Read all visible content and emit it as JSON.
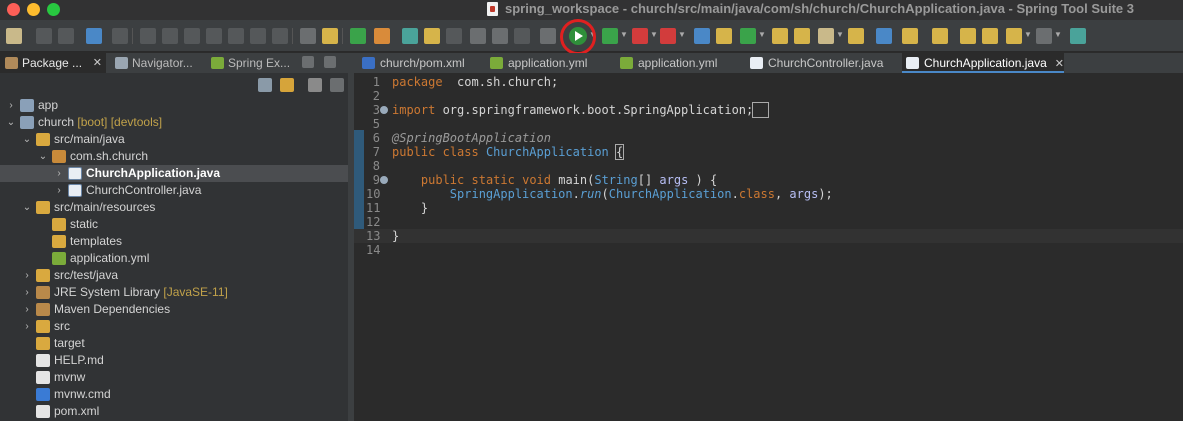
{
  "window": {
    "title": "spring_workspace - church/src/main/java/com/sh/church/ChurchApplication.java - Spring Tool Suite 3"
  },
  "toolbar": {
    "run_button_icon": "run-icon",
    "run_highlight_color": "#e02020"
  },
  "left_panel": {
    "tabs": [
      {
        "label": "Package ...",
        "icon": "package-explorer-icon",
        "active": true
      },
      {
        "label": "Navigator...",
        "icon": "navigator-icon",
        "active": false
      },
      {
        "label": "Spring Ex...",
        "icon": "spring-icon",
        "active": false
      }
    ],
    "close_glyph": "✕",
    "tree": [
      {
        "label": "app",
        "deco": "",
        "icon": "project-icon",
        "depth": 0,
        "twisty": "›",
        "selected": false
      },
      {
        "label": "church",
        "deco": " [boot] [devtools]",
        "icon": "project-icon",
        "depth": 0,
        "twisty": "⌄",
        "selected": false
      },
      {
        "label": "src/main/java",
        "deco": "",
        "icon": "source-folder-icon",
        "depth": 1,
        "twisty": "⌄",
        "selected": false
      },
      {
        "label": "com.sh.church",
        "deco": "",
        "icon": "package-icon",
        "depth": 2,
        "twisty": "⌄",
        "selected": false
      },
      {
        "label": "ChurchApplication.java",
        "deco": "",
        "icon": "java-file-icon",
        "depth": 3,
        "twisty": "›",
        "selected": true
      },
      {
        "label": "ChurchController.java",
        "deco": "",
        "icon": "java-file-icon",
        "depth": 3,
        "twisty": "›",
        "selected": false
      },
      {
        "label": "src/main/resources",
        "deco": "",
        "icon": "source-folder-icon",
        "depth": 1,
        "twisty": "⌄",
        "selected": false
      },
      {
        "label": "static",
        "deco": "",
        "icon": "folder-icon",
        "depth": 2,
        "twisty": "",
        "selected": false
      },
      {
        "label": "templates",
        "deco": "",
        "icon": "folder-icon",
        "depth": 2,
        "twisty": "",
        "selected": false
      },
      {
        "label": "application.yml",
        "deco": "",
        "icon": "yml-file-icon",
        "depth": 2,
        "twisty": "",
        "selected": false
      },
      {
        "label": "src/test/java",
        "deco": "",
        "icon": "source-folder-icon",
        "depth": 1,
        "twisty": "›",
        "selected": false
      },
      {
        "label": "JRE System Library",
        "deco": " [JavaSE-11]",
        "icon": "library-icon",
        "depth": 1,
        "twisty": "›",
        "selected": false
      },
      {
        "label": "Maven Dependencies",
        "deco": "",
        "icon": "library-icon",
        "depth": 1,
        "twisty": "›",
        "selected": false
      },
      {
        "label": "src",
        "deco": "",
        "icon": "folder-icon",
        "depth": 1,
        "twisty": "›",
        "selected": false
      },
      {
        "label": "target",
        "deco": "",
        "icon": "folder-icon",
        "depth": 1,
        "twisty": "",
        "selected": false
      },
      {
        "label": "HELP.md",
        "deco": "",
        "icon": "markdown-file-icon",
        "depth": 1,
        "twisty": "",
        "selected": false
      },
      {
        "label": "mvnw",
        "deco": "",
        "icon": "text-file-icon",
        "depth": 1,
        "twisty": "",
        "selected": false
      },
      {
        "label": "mvnw.cmd",
        "deco": "",
        "icon": "cmd-file-icon",
        "depth": 1,
        "twisty": "",
        "selected": false
      },
      {
        "label": "pom.xml",
        "deco": "",
        "icon": "xml-file-icon",
        "depth": 1,
        "twisty": "",
        "selected": false
      }
    ]
  },
  "editor": {
    "tabs": [
      {
        "label": "church/pom.xml",
        "icon": "maven-icon",
        "active": false
      },
      {
        "label": "application.yml",
        "icon": "yml-file-icon",
        "active": false
      },
      {
        "label": "application.yml",
        "icon": "yml-file-icon",
        "active": false
      },
      {
        "label": "ChurchController.java",
        "icon": "java-file-icon",
        "active": false
      },
      {
        "label": "ChurchApplication.java",
        "icon": "java-file-icon",
        "active": true
      }
    ],
    "close_glyph": "✕",
    "lines": [
      {
        "n": "1",
        "fold": false,
        "hl": false,
        "segs": [
          [
            "kw",
            "package"
          ],
          [
            "",
            "  com.sh.church;"
          ]
        ]
      },
      {
        "n": "2",
        "fold": false,
        "hl": false,
        "segs": []
      },
      {
        "n": "3",
        "fold": true,
        "hl": false,
        "segs": [
          [
            "kw",
            "import"
          ],
          [
            "",
            " org.springframework.boot.SpringApplication;"
          ],
          [
            "brk",
            "  "
          ]
        ]
      },
      {
        "n": "5",
        "fold": false,
        "hl": false,
        "segs": []
      },
      {
        "n": "6",
        "fold": false,
        "hl": false,
        "segs": [
          [
            "ann",
            "@SpringBootApplication"
          ]
        ]
      },
      {
        "n": "7",
        "fold": false,
        "hl": false,
        "segs": [
          [
            "kw",
            "public"
          ],
          [
            "",
            " "
          ],
          [
            "kw",
            "class"
          ],
          [
            "",
            " "
          ],
          [
            "cls",
            "ChurchApplication"
          ],
          [
            "",
            " "
          ],
          [
            "brk",
            "{"
          ]
        ]
      },
      {
        "n": "8",
        "fold": false,
        "hl": false,
        "segs": []
      },
      {
        "n": "9",
        "fold": true,
        "hl": false,
        "segs": [
          [
            "",
            "    "
          ],
          [
            "kw",
            "public"
          ],
          [
            "",
            " "
          ],
          [
            "kw",
            "static"
          ],
          [
            "",
            " "
          ],
          [
            "kw",
            "void"
          ],
          [
            "",
            " main("
          ],
          [
            "cls",
            "String"
          ],
          [
            "",
            "[] "
          ],
          [
            "var",
            "args"
          ],
          [
            "",
            " ) {"
          ]
        ]
      },
      {
        "n": "10",
        "fold": false,
        "hl": false,
        "segs": [
          [
            "",
            "        "
          ],
          [
            "cls",
            "SpringApplication"
          ],
          [
            "",
            "."
          ],
          [
            "meth",
            "run"
          ],
          [
            "",
            "("
          ],
          [
            "cls",
            "ChurchApplication"
          ],
          [
            "",
            "."
          ],
          [
            "kw",
            "class"
          ],
          [
            "",
            ", "
          ],
          [
            "var",
            "args"
          ],
          [
            "",
            ");"
          ]
        ]
      },
      {
        "n": "11",
        "fold": false,
        "hl": false,
        "segs": [
          [
            "",
            "    }"
          ]
        ]
      },
      {
        "n": "12",
        "fold": false,
        "hl": false,
        "segs": []
      },
      {
        "n": "13",
        "fold": false,
        "hl": true,
        "segs": [
          [
            "",
            "}"
          ]
        ]
      },
      {
        "n": "14",
        "fold": false,
        "hl": false,
        "segs": []
      }
    ]
  }
}
